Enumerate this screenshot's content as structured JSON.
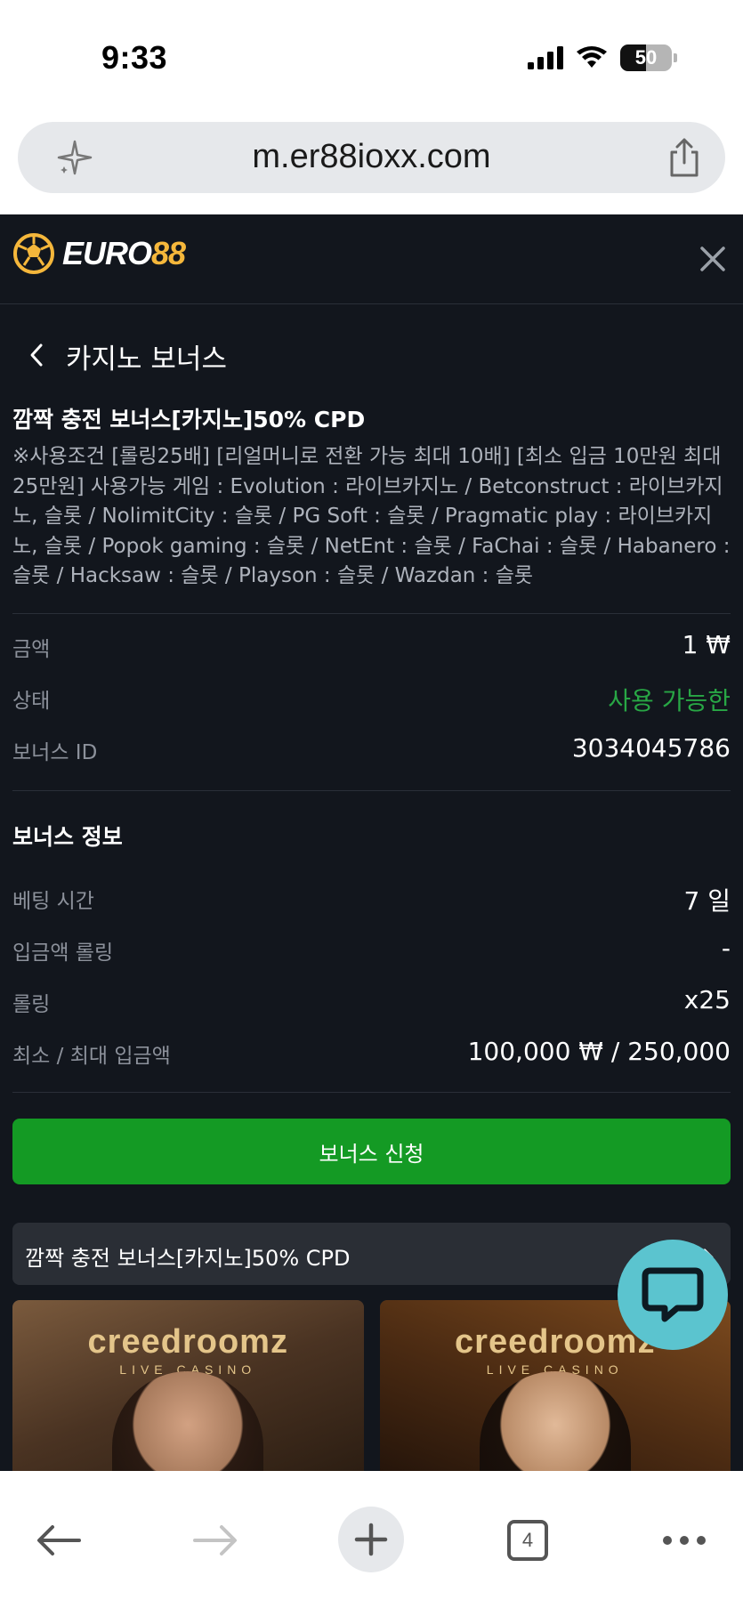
{
  "status_bar": {
    "time": "9:33",
    "battery": "50",
    "icons": [
      "signal-icon",
      "wifi-icon",
      "battery-icon"
    ]
  },
  "browser": {
    "url": "m.er88ioxx.com"
  },
  "header": {
    "logo_main": "EURO",
    "logo_num": "88"
  },
  "page": {
    "title": "카지노 보너스"
  },
  "bonus": {
    "name": "깜짝 충전 보너스[카지노]50% CPD",
    "description": "※사용조건 [롤링25배] [리얼머니로 전환 가능 최대 10배] [최소 입금 10만원 최대 25만원] 사용가능 게임 : Evolution : 라이브카지노 / Betconstruct : 라이브카지노, 슬롯 / NolimitCity : 슬롯 / PG Soft : 슬롯 / Pragmatic play : 라이브카지노, 슬롯 / Popok gaming : 슬롯 / NetEnt : 슬롯 / FaChai : 슬롯 / Habanero : 슬롯 / Hacksaw : 슬롯 / Playson : 슬롯 / Wazdan : 슬롯",
    "amount_label": "금액",
    "amount_value": "1 ₩",
    "status_label": "상태",
    "status_value": "사용 가능한",
    "id_label": "보너스 ID",
    "id_value": "3034045786"
  },
  "info": {
    "title": "보너스 정보",
    "betting_time_label": "베팅 시간",
    "betting_time_value": "7 일",
    "deposit_rolling_label": "입금액 롤링",
    "deposit_rolling_value": "-",
    "rolling_label": "롤링",
    "rolling_value": "x25",
    "min_max_label": "최소 / 최대 입금액",
    "min_max_value": "100,000 ₩ / 250,000"
  },
  "actions": {
    "apply_label": "보너스 신청"
  },
  "accordion": {
    "label": "깜짝 충전 보너스[카지노]50% CPD"
  },
  "games": [
    {
      "brand": "creedroomz",
      "sub": "LIVE CASINO"
    },
    {
      "brand": "creedroomz",
      "sub": "LIVE CASINO"
    }
  ],
  "toolbar": {
    "tab_count": "4"
  },
  "colors": {
    "app_bg": "#12161d",
    "accent_green": "#149a24",
    "status_green": "#28a745",
    "logo_gold": "#f5b73b",
    "chat_bubble": "#5bc4cf"
  }
}
